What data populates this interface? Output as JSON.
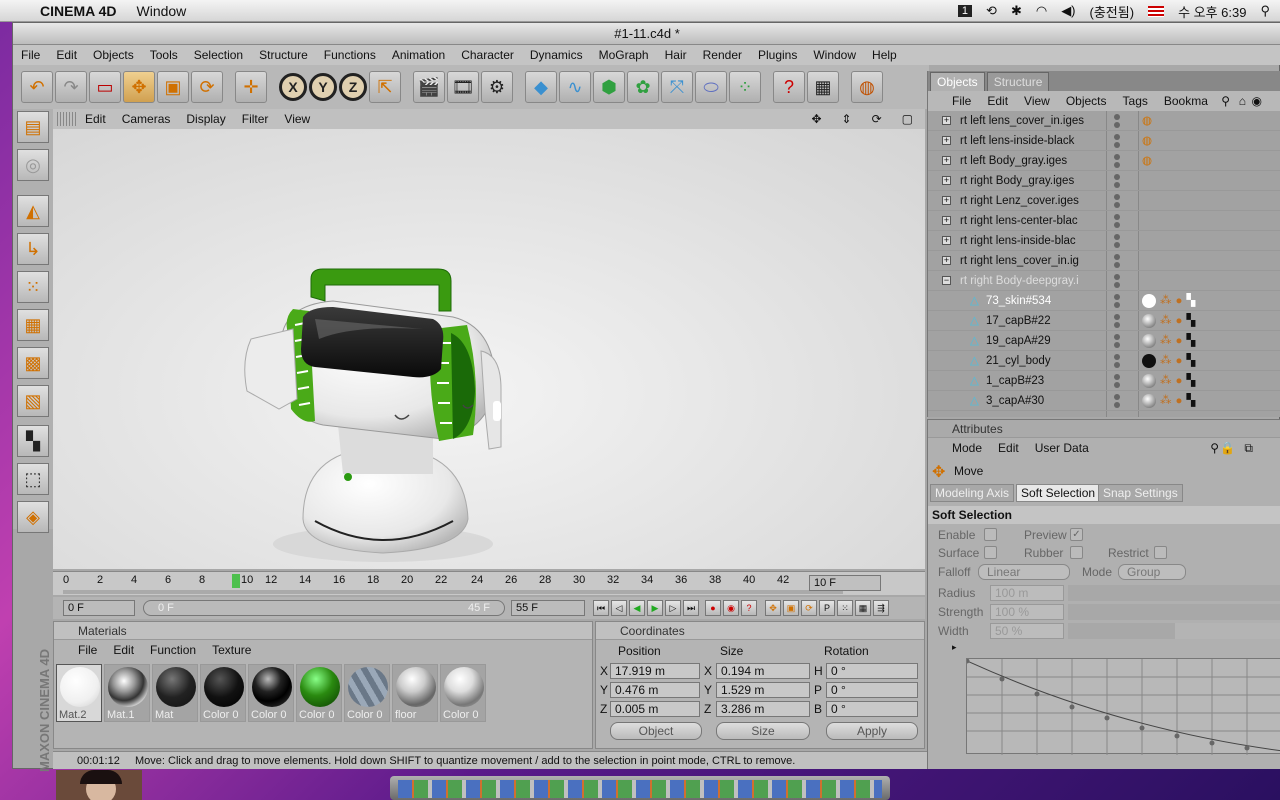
{
  "mac_menubar": {
    "app_name": "CINEMA 4D",
    "window_menu": "Window",
    "status_input": "(충전됨)",
    "clock": "수 오후 6:39"
  },
  "window": {
    "title": "#1-11.c4d *"
  },
  "main_menu": [
    "File",
    "Edit",
    "Objects",
    "Tools",
    "Selection",
    "Structure",
    "Functions",
    "Animation",
    "Character",
    "Dynamics",
    "MoGraph",
    "Hair",
    "Render",
    "Plugins",
    "Window",
    "Help"
  ],
  "viewport": {
    "menu": [
      "Edit",
      "Cameras",
      "Display",
      "Filter",
      "View"
    ]
  },
  "timeline": {
    "ticks": [
      "0",
      "2",
      "4",
      "6",
      "8",
      "10",
      "12",
      "14",
      "16",
      "18",
      "20",
      "22",
      "24",
      "26",
      "28",
      "30",
      "32",
      "34",
      "36",
      "38",
      "40",
      "42",
      "44"
    ],
    "current_frame": "10 F",
    "start_field": "0 F",
    "range_start": "0 F",
    "range_end": "45 F",
    "end_field": "55 F"
  },
  "materials": {
    "header": "Materials",
    "menu": [
      "File",
      "Edit",
      "Function",
      "Texture"
    ],
    "items": [
      {
        "label": "Mat.2",
        "type": "white"
      },
      {
        "label": "Mat.1",
        "type": "chrome"
      },
      {
        "label": "Mat",
        "type": "black"
      },
      {
        "label": "Color 0",
        "type": "black"
      },
      {
        "label": "Color 0",
        "type": "glossy-black"
      },
      {
        "label": "Color 0",
        "type": "green"
      },
      {
        "label": "Color 0",
        "type": "stripes"
      },
      {
        "label": "floor",
        "type": "silver"
      },
      {
        "label": "Color 0",
        "type": "silver"
      }
    ]
  },
  "coordinates": {
    "header": "Coordinates",
    "col_position": "Position",
    "col_size": "Size",
    "col_rotation": "Rotation",
    "rows": [
      {
        "axis": "X",
        "pos": "17.919 m",
        "size_axis": "X",
        "size": "0.194 m",
        "rot_axis": "H",
        "rot": "0 °"
      },
      {
        "axis": "Y",
        "pos": "0.476 m",
        "size_axis": "Y",
        "size": "1.529 m",
        "rot_axis": "P",
        "rot": "0 °"
      },
      {
        "axis": "Z",
        "pos": "0.005 m",
        "size_axis": "Z",
        "size": "3.286 m",
        "rot_axis": "B",
        "rot": "0 °"
      }
    ],
    "mode_select": "Object",
    "size_select": "Size",
    "apply": "Apply"
  },
  "status": {
    "time": "00:01:12",
    "message": "Move: Click and drag to move elements. Hold down SHIFT to quantize movement / add to the selection in point mode, CTRL to remove."
  },
  "objects_panel": {
    "tab_objects": "Objects",
    "tab_structure": "Structure",
    "menu": [
      "File",
      "Edit",
      "View",
      "Objects",
      "Tags",
      "Bookma"
    ],
    "rows": [
      {
        "name": "rt left lens_cover_in.iges",
        "indent": 0,
        "tags": "sphere"
      },
      {
        "name": "rt left lens-inside-black",
        "indent": 0,
        "tags": "sphere"
      },
      {
        "name": "rt left Body_gray.iges",
        "indent": 0,
        "tags": "sphere"
      },
      {
        "name": "rt right Body_gray.iges",
        "indent": 0,
        "tags": ""
      },
      {
        "name": "rt right Lenz_cover.iges",
        "indent": 0,
        "tags": ""
      },
      {
        "name": "rt right lens-center-blac",
        "indent": 0,
        "tags": ""
      },
      {
        "name": "rt right lens-inside-blac",
        "indent": 0,
        "tags": ""
      },
      {
        "name": "rt right lens_cover_in.ig",
        "indent": 0,
        "tags": ""
      },
      {
        "name": "rt right Body-deepgray.i",
        "indent": 0,
        "tags": "",
        "dim": true
      },
      {
        "name": "73_skin#534",
        "indent": 1,
        "tags": "white"
      },
      {
        "name": "17_capB#22",
        "indent": 1,
        "tags": "silver"
      },
      {
        "name": "19_capA#29",
        "indent": 1,
        "tags": "silver"
      },
      {
        "name": "21_cyl_body",
        "indent": 1,
        "tags": "black"
      },
      {
        "name": "1_capB#23",
        "indent": 1,
        "tags": "silver"
      },
      {
        "name": "3_capA#30",
        "indent": 1,
        "tags": "silver"
      }
    ]
  },
  "attributes": {
    "header": "Attributes",
    "menu": [
      "Mode",
      "Edit",
      "User Data"
    ],
    "tool": "Move",
    "tabs": [
      "Modeling Axis",
      "Soft Selection",
      "Snap Settings"
    ],
    "active_tab": "Soft Selection",
    "section": "Soft Selection",
    "enable": "Enable",
    "preview": "Preview",
    "surface": "Surface",
    "rubber": "Rubber",
    "restrict": "Restrict",
    "falloff_label": "Falloff",
    "falloff_value": "Linear",
    "mode_label": "Mode",
    "mode_value": "Group",
    "radius_label": "Radius",
    "radius_value": "100 m",
    "strength_label": "Strength",
    "strength_value": "100 %",
    "width_label": "Width",
    "width_value": "50 %"
  },
  "maxon_logo": "MAXON CINEMA 4D"
}
